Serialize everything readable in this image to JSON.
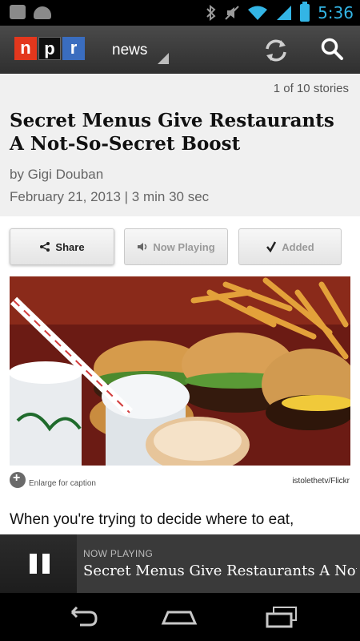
{
  "status_bar": {
    "time": "5:36",
    "icons": [
      "notification-icon",
      "android-icon",
      "bluetooth-icon",
      "mute-icon",
      "wifi-icon",
      "signal-icon",
      "battery-icon"
    ]
  },
  "app_bar": {
    "logo_letters": [
      "n",
      "p",
      "r"
    ],
    "section": "news",
    "actions": [
      "refresh-icon",
      "search-icon"
    ],
    "colors": {
      "n": "#e3371d",
      "p": "#0f0f0f",
      "r": "#3a6dbf"
    }
  },
  "story": {
    "count_label": "1 of 10 stories",
    "headline": "Secret Menus Give Restaurants A Not-So-Secret Boost",
    "byline": "by Gigi Douban",
    "date_duration": "February 21, 2013 | 3 min 30 sec",
    "buttons": {
      "share": "Share",
      "now_playing": "Now Playing",
      "added": "Added"
    },
    "photo": {
      "enlarge_caption": "Enlarge for caption",
      "credit": "istolethetv/Flickr"
    },
    "body_start": "When you're trying to decide where to eat,"
  },
  "player": {
    "label": "NOW PLAYING",
    "title": "Secret Menus Give Restaurants A Not-S..."
  }
}
